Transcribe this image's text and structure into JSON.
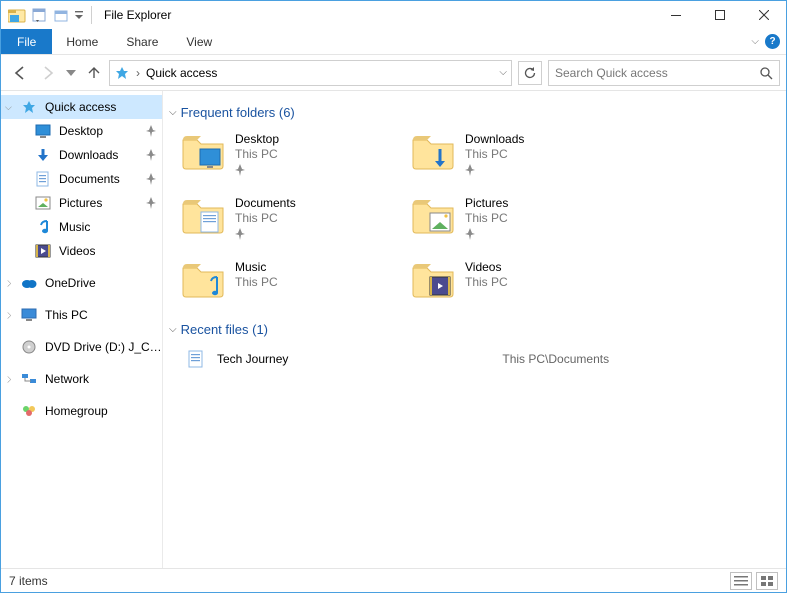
{
  "title": "File Explorer",
  "ribbon": {
    "file": "File",
    "home": "Home",
    "share": "Share",
    "view": "View"
  },
  "address": {
    "location": "Quick access"
  },
  "search": {
    "placeholder": "Search Quick access"
  },
  "sidebar": {
    "quick_access": "Quick access",
    "pins": [
      {
        "label": "Desktop"
      },
      {
        "label": "Downloads"
      },
      {
        "label": "Documents"
      },
      {
        "label": "Pictures"
      },
      {
        "label": "Music"
      },
      {
        "label": "Videos"
      }
    ],
    "onedrive": "OneDrive",
    "thispc": "This PC",
    "dvd": "DVD Drive (D:) J_CPRA",
    "network": "Network",
    "homegroup": "Homegroup"
  },
  "content": {
    "freq_header": "Frequent folders (6)",
    "recent_header": "Recent files (1)",
    "folders": [
      {
        "name": "Desktop",
        "sub": "This PC",
        "icon": "desktop",
        "pinned": true
      },
      {
        "name": "Downloads",
        "sub": "This PC",
        "icon": "downloads",
        "pinned": true
      },
      {
        "name": "Documents",
        "sub": "This PC",
        "icon": "documents",
        "pinned": true
      },
      {
        "name": "Pictures",
        "sub": "This PC",
        "icon": "pictures",
        "pinned": true
      },
      {
        "name": "Music",
        "sub": "This PC",
        "icon": "music",
        "pinned": false
      },
      {
        "name": "Videos",
        "sub": "This PC",
        "icon": "videos",
        "pinned": false
      }
    ],
    "recent": [
      {
        "name": "Tech Journey",
        "path": "This PC\\Documents"
      }
    ]
  },
  "status": {
    "text": "7 items"
  }
}
